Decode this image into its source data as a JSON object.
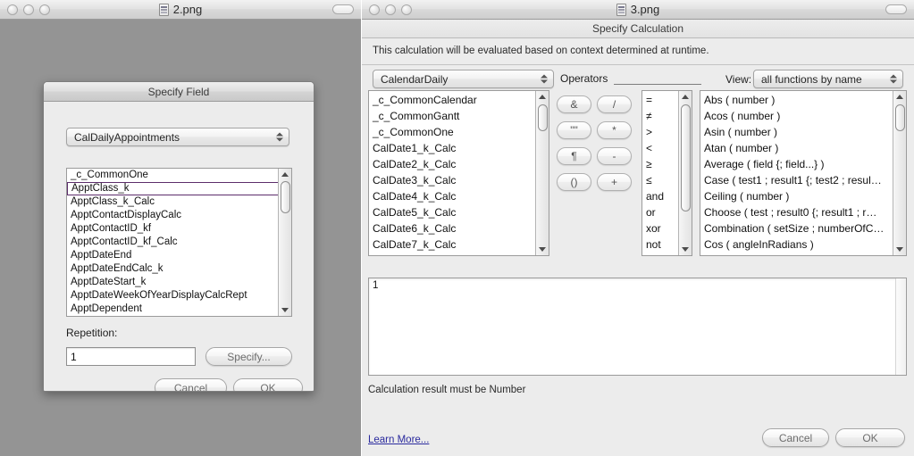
{
  "windows": {
    "left": {
      "title": "2.png",
      "icon": "document-icon"
    },
    "right": {
      "title": "3.png",
      "icon": "document-icon",
      "subtitle": "Specify Calculation"
    }
  },
  "specify_field": {
    "title": "Specify Field",
    "table_popup": {
      "value": "CalDailyAppointments"
    },
    "fields": [
      "_c_CommonOne",
      "ApptClass_k",
      "ApptClass_k_Calc",
      "ApptContactDisplayCalc",
      "ApptContactID_kf",
      "ApptContactID_kf_Calc",
      "ApptDateEnd",
      "ApptDateEndCalc_k",
      "ApptDateStart_k",
      "ApptDateWeekOfYearDisplayCalcRept",
      "ApptDependent"
    ],
    "selected_field": "ApptClass_k",
    "selected_index": 1,
    "repetition_label": "Repetition:",
    "repetition_value": "1",
    "specify_button": "Specify...",
    "cancel_button": "Cancel",
    "ok_button": "OK"
  },
  "specify_calculation": {
    "hint": "This calculation will be evaluated based on context determined at runtime.",
    "context_popup": {
      "value": "CalendarDaily"
    },
    "operators_label": "Operators",
    "view_label": "View:",
    "view_popup": {
      "value": "all functions by name"
    },
    "fields_list": [
      "_c_CommonCalendar",
      "_c_CommonGantt",
      "_c_CommonOne",
      "CalDate1_k_Calc",
      "CalDate2_k_Calc",
      "CalDate3_k_Calc",
      "CalDate4_k_Calc",
      "CalDate5_k_Calc",
      "CalDate6_k_Calc",
      "CalDate7_k_Calc"
    ],
    "operator_keys": [
      "&",
      "/",
      "\"\"",
      "*",
      "¶",
      "-",
      "()",
      "+"
    ],
    "operators_list": [
      "=",
      "≠",
      ">",
      "<",
      "≥",
      "≤",
      "and",
      "or",
      "xor",
      "not"
    ],
    "functions_list": [
      "Abs ( number )",
      "Acos ( number )",
      "Asin ( number )",
      "Atan ( number )",
      "Average ( field {; field...} )",
      "Case ( test1 ; result1 {; test2 ; resul…",
      "Ceiling ( number )",
      "Choose ( test ; result0 {; result1 ; r…",
      "Combination ( setSize ; numberOfC…",
      "Cos ( angleInRadians )"
    ],
    "formula_text": "1",
    "result_note": "Calculation result must be Number",
    "learn_more": "Learn More...",
    "cancel_button": "Cancel",
    "ok_button": "OK"
  },
  "colors": {
    "desktop_gray": "#949494",
    "chrome_gray": "#ececec",
    "selection_outline": "#5c2d6b",
    "link_blue": "#2b2b9e"
  }
}
